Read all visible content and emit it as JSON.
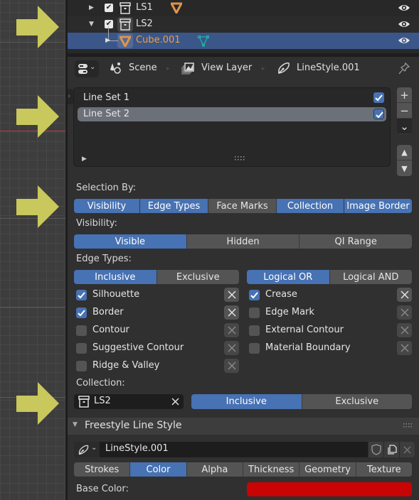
{
  "outliner": {
    "rows": [
      {
        "label": "LS1",
        "expanded": false,
        "checked": true,
        "type": "collection",
        "extra_icon": "object-data-icon",
        "visible": true
      },
      {
        "label": "LS2",
        "expanded": true,
        "checked": true,
        "type": "collection",
        "visible": true
      },
      {
        "label": "Cube.001",
        "expanded": false,
        "type": "object",
        "extra_icon": "mesh-data-icon",
        "selected": true,
        "visible": true
      }
    ]
  },
  "header": {
    "breadcrumbs": [
      {
        "label": "Scene",
        "icon": "scene-icon"
      },
      {
        "label": "View Layer",
        "icon": "view-layer-icon"
      },
      {
        "label": "LineStyle.001",
        "icon": "linestyle-icon"
      }
    ]
  },
  "line_sets": {
    "items": [
      {
        "label": "Line Set 1",
        "enabled": true,
        "selected": false
      },
      {
        "label": "Line Set 2",
        "enabled": true,
        "selected": true
      }
    ],
    "side_buttons": [
      "+",
      "−",
      "⌄"
    ],
    "move_buttons": [
      "▲",
      "▼"
    ]
  },
  "selection_by": {
    "label": "Selection By:",
    "options": [
      {
        "label": "Visibility",
        "active": true
      },
      {
        "label": "Edge Types",
        "active": true
      },
      {
        "label": "Face Marks",
        "active": false
      },
      {
        "label": "Collection",
        "active": true
      },
      {
        "label": "Image Border",
        "active": true
      }
    ]
  },
  "visibility": {
    "label": "Visibility:",
    "options": [
      {
        "label": "Visible",
        "active": true
      },
      {
        "label": "Hidden",
        "active": false
      },
      {
        "label": "QI Range",
        "active": false
      }
    ]
  },
  "edge_types": {
    "label": "Edge Types:",
    "mode_options": [
      {
        "label": "Inclusive",
        "active": true
      },
      {
        "label": "Exclusive",
        "active": false
      }
    ],
    "logic_options": [
      {
        "label": "Logical OR",
        "active": true
      },
      {
        "label": "Logical AND",
        "active": false
      }
    ],
    "left": [
      {
        "label": "Silhouette",
        "checked": true
      },
      {
        "label": "Border",
        "checked": true
      },
      {
        "label": "Contour",
        "checked": false
      },
      {
        "label": "Suggestive Contour",
        "checked": false
      },
      {
        "label": "Ridge & Valley",
        "checked": false
      }
    ],
    "right": [
      {
        "label": "Crease",
        "checked": true
      },
      {
        "label": "Edge Mark",
        "checked": false
      },
      {
        "label": "External Contour",
        "checked": false
      },
      {
        "label": "Material Boundary",
        "checked": false
      }
    ]
  },
  "collection": {
    "label": "Collection:",
    "value": "LS2",
    "options": [
      {
        "label": "Inclusive",
        "active": true
      },
      {
        "label": "Exclusive",
        "active": false
      }
    ]
  },
  "line_style": {
    "panel_title": "Freestyle Line Style",
    "name": "LineStyle.001",
    "tabs": [
      {
        "label": "Strokes",
        "active": false
      },
      {
        "label": "Color",
        "active": true
      },
      {
        "label": "Alpha",
        "active": false
      },
      {
        "label": "Thickness",
        "active": false
      },
      {
        "label": "Geometry",
        "active": false
      },
      {
        "label": "Texture",
        "active": false
      }
    ],
    "base_color_label": "Base Color:",
    "base_color": "#c80404"
  },
  "colors": {
    "accent": "#4772b3",
    "selected_row": "#3b5689",
    "arrow": "#c8c85c",
    "object_orange": "#e0944a",
    "mesh_teal": "#1fb3a5"
  }
}
